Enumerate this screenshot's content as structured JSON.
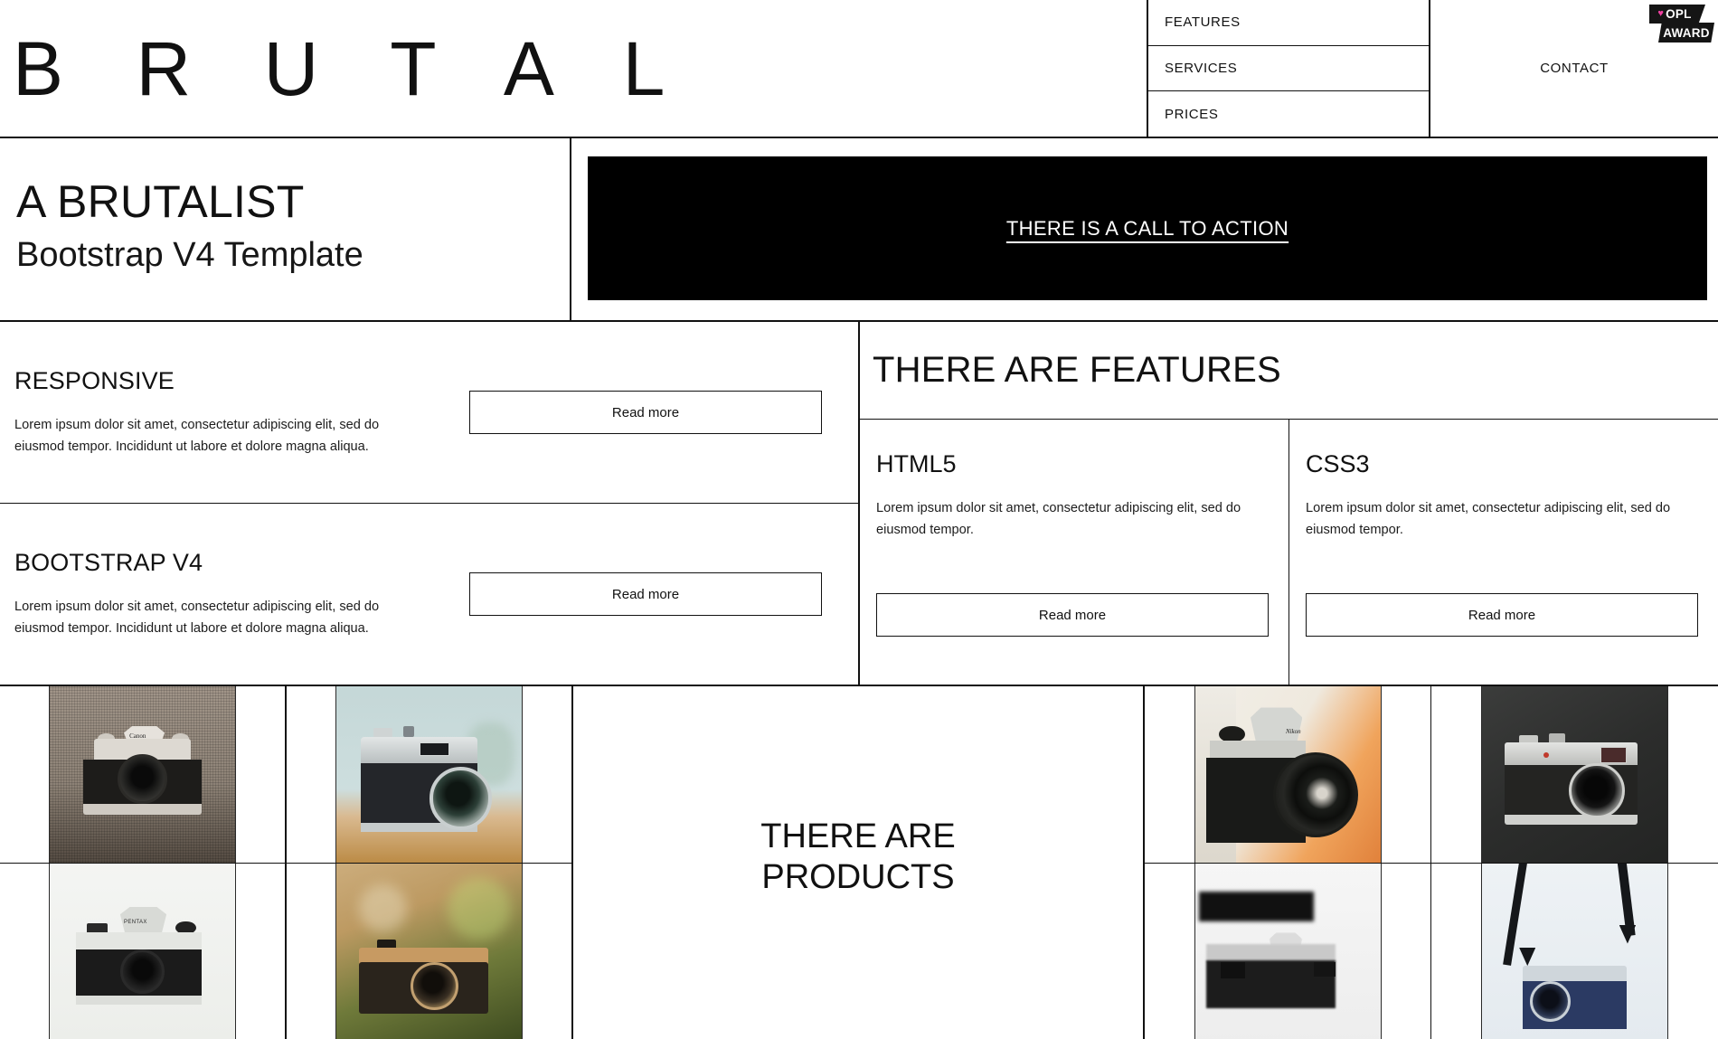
{
  "header": {
    "brand": "B R U T A L",
    "nav": [
      {
        "label": "FEATURES"
      },
      {
        "label": "SERVICES"
      },
      {
        "label": "PRICES"
      }
    ],
    "contact": "CONTACT",
    "award": {
      "heart": "♥",
      "line1": "OPL",
      "line2": "AWARD"
    }
  },
  "hero": {
    "title": "A BRUTALIST",
    "subtitle": "Bootstrap V4 Template",
    "cta_label": "THERE IS A CALL TO ACTION"
  },
  "panels": [
    {
      "heading": "RESPONSIVE",
      "body": "Lorem ipsum dolor sit amet, consectetur adipiscing elit, sed do eiusmod tempor. Incididunt ut labore et dolore magna aliqua.",
      "button": "Read more"
    },
    {
      "heading": "BOOTSTRAP V4",
      "body": "Lorem ipsum dolor sit amet, consectetur adipiscing elit, sed do eiusmod tempor. Incididunt ut labore et dolore magna aliqua.",
      "button": "Read more"
    }
  ],
  "features": {
    "heading": "THERE ARE FEATURES",
    "cards": [
      {
        "title": "HTML5",
        "body": "Lorem ipsum dolor sit amet, consectetur adipiscing elit, sed do eiusmod tempor.",
        "button": "Read more"
      },
      {
        "title": "CSS3",
        "body": "Lorem ipsum dolor sit amet, consectetur adipiscing elit, sed do eiusmod tempor.",
        "button": "Read more"
      }
    ]
  },
  "products": {
    "heading_line1": "THERE ARE",
    "heading_line2": "PRODUCTS",
    "items": [
      {
        "alt": "canon-ae1-camera-on-burlap"
      },
      {
        "alt": "yashica-rangefinder-camera-on-wood"
      },
      {
        "alt": "asahi-pentax-camera-on-white"
      },
      {
        "alt": "vintage-camera-green-bokeh"
      },
      {
        "alt": "nikon-slr-camera-closeup"
      },
      {
        "alt": "fujifilm-x100-camera-on-dark"
      },
      {
        "alt": "black-white-camera-closeup"
      },
      {
        "alt": "camera-with-neck-strap"
      }
    ]
  },
  "colors": {
    "ink": "#111111",
    "paper": "#ffffff",
    "cta_background": "#000000",
    "award_pink": "#ef3fa0"
  }
}
